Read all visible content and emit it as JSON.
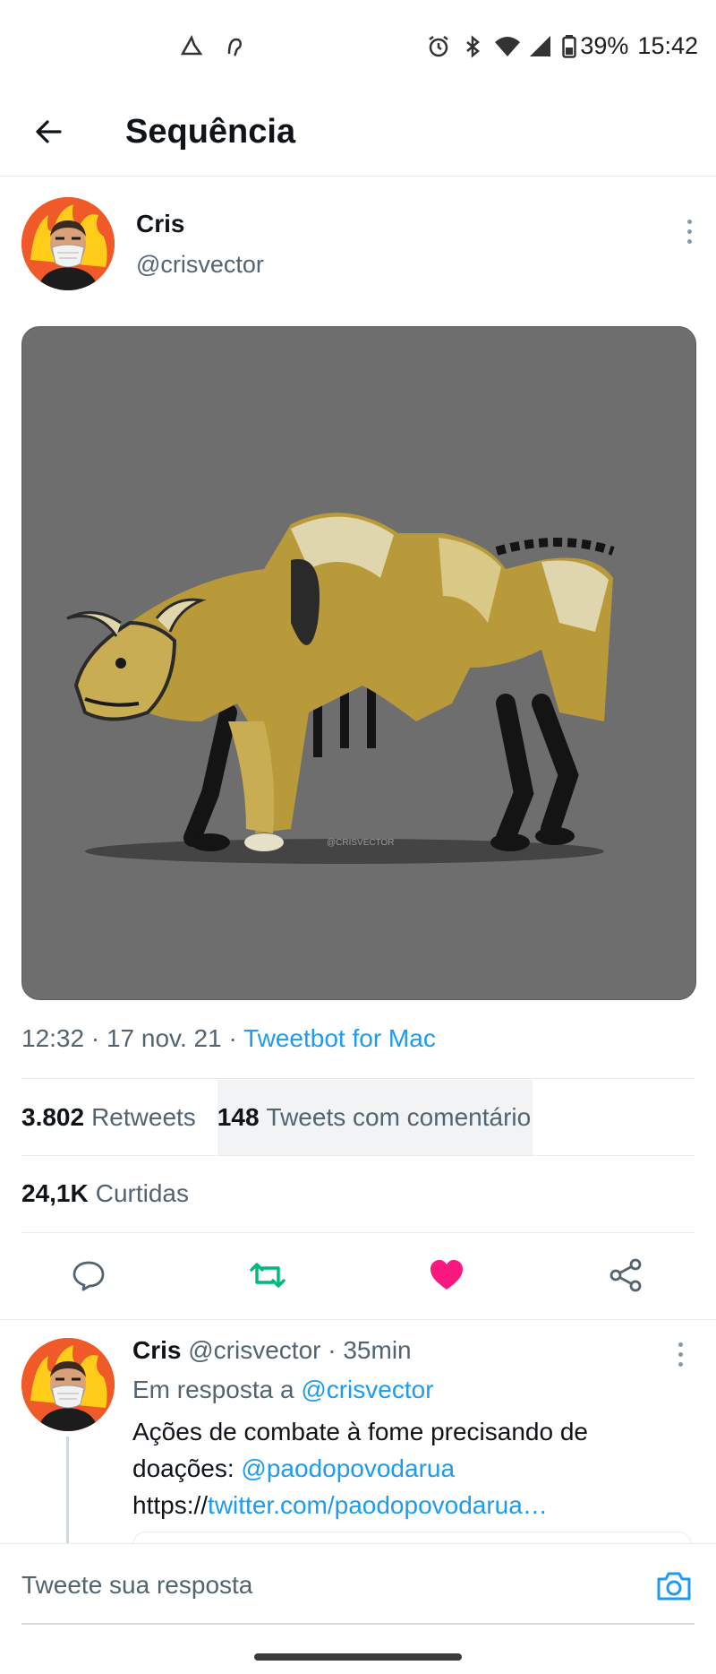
{
  "status_bar": {
    "battery": "39%",
    "time": "15:42"
  },
  "header": {
    "title": "Sequência"
  },
  "tweet": {
    "author_name": "Cris",
    "author_handle": "@crisvector",
    "media_watermark": "@CRISVECTOR",
    "time": "12:32",
    "date": "17 nov. 21",
    "source": "Tweetbot for Mac",
    "stats": {
      "retweets_count": "3.802",
      "retweets_label": "Retweets",
      "quotes_count": "148",
      "quotes_label": "Tweets com comentário",
      "likes_count": "24,1K",
      "likes_label": "Curtidas"
    },
    "liked": true
  },
  "reply": {
    "author_name": "Cris",
    "author_handle": "@crisvector",
    "age": "35min",
    "in_reply_prefix": "Em resposta a",
    "in_reply_handle": "@crisvector",
    "text_1": "Ações de combate à fome precisando de",
    "text_2_prefix": "doações:",
    "text_2_link": "@paodopovodarua",
    "text_3_prefix": "https://",
    "text_3_link": "twitter.com/paodopovodarua…"
  },
  "compose": {
    "placeholder": "Tweete sua resposta"
  },
  "colors": {
    "accent": "#1d9bf0",
    "retweet": "#00ba7c",
    "like": "#f91880",
    "muted": "#536471"
  }
}
